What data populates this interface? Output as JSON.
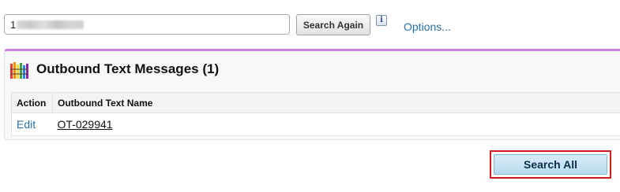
{
  "search": {
    "value": "1",
    "again_label": "Search Again",
    "info_icon": "info-icon",
    "options_label": "Options..."
  },
  "panel": {
    "icon": "colorful-grid-icon",
    "title": "Outbound Text Messages (1)",
    "accent_color": "#c985e0",
    "columns": [
      "Action",
      "Outbound Text Name"
    ],
    "rows": [
      {
        "action": "Edit",
        "name": "OT-029941"
      }
    ]
  },
  "footer": {
    "search_all_label": "Search All",
    "highlight_color": "#d01c1c"
  }
}
